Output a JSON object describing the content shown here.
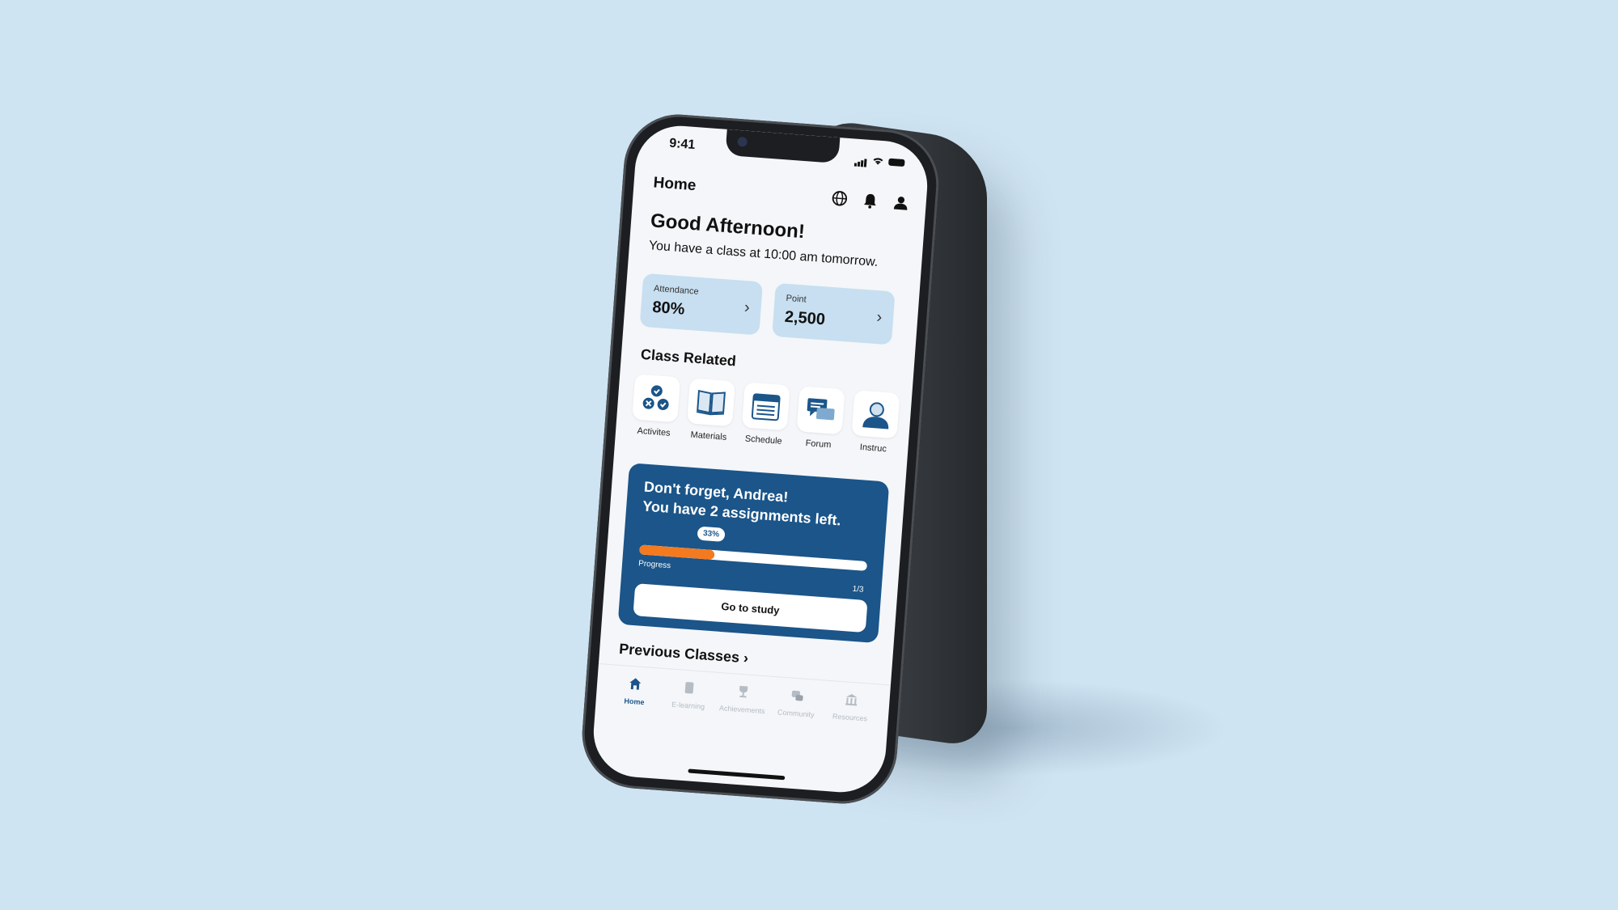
{
  "status_bar": {
    "time": "9:41"
  },
  "header": {
    "title": "Home",
    "icons": [
      "globe-icon",
      "bell-icon",
      "profile-icon"
    ]
  },
  "greeting": {
    "title": "Good Afternoon!",
    "subtitle": "You have a class at 10:00 am tomorrow."
  },
  "stats": [
    {
      "label": "Attendance",
      "value": "80%"
    },
    {
      "label": "Point",
      "value": "2,500"
    }
  ],
  "class_related": {
    "title": "Class Related",
    "items": [
      {
        "label": "Activites",
        "icon": "activities-icon"
      },
      {
        "label": "Materials",
        "icon": "book-icon"
      },
      {
        "label": "Schedule",
        "icon": "calendar-icon"
      },
      {
        "label": "Forum",
        "icon": "chat-icon"
      },
      {
        "label": "Instruc",
        "icon": "instructor-icon"
      }
    ]
  },
  "reminder": {
    "line1": "Don't forget, Andrea!",
    "line2": "You have 2 assignments left.",
    "progress_pct_label": "33%",
    "progress_fraction": 0.33,
    "progress_label": "Progress",
    "progress_count": "1/3",
    "button": "Go to study"
  },
  "previous_classes": {
    "title": "Previous Classes"
  },
  "tab_bar": [
    {
      "label": "Home",
      "icon": "home-icon",
      "active": true
    },
    {
      "label": "E-learning",
      "icon": "tablet-icon",
      "active": false
    },
    {
      "label": "Achievements",
      "icon": "trophy-icon",
      "active": false
    },
    {
      "label": "Community",
      "icon": "community-icon",
      "active": false
    },
    {
      "label": "Resources",
      "icon": "library-icon",
      "active": false
    }
  ],
  "colors": {
    "background": "#cfe4f2",
    "primary": "#1b5589",
    "accent": "#f47a20",
    "card": "#c7dff0"
  }
}
